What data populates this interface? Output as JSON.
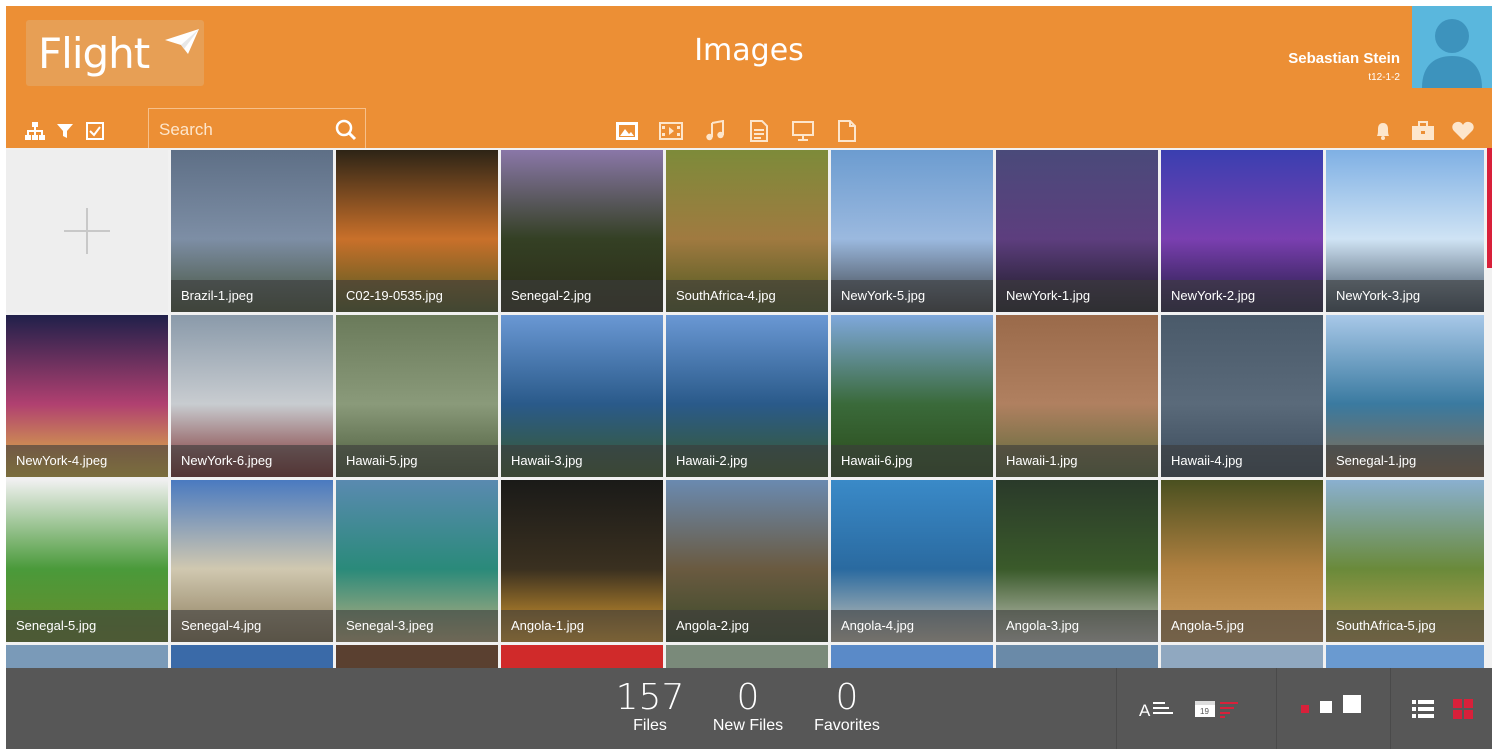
{
  "app": {
    "name": "Flight",
    "page_title": "Images"
  },
  "user": {
    "name": "Sebastian Stein",
    "id": "t12-1-2"
  },
  "search": {
    "placeholder": "Search"
  },
  "toolbar": {
    "left_icons": [
      "hierarchy-icon",
      "filter-icon",
      "checkbox-icon"
    ],
    "type_icons": [
      "image-icon",
      "video-icon",
      "music-icon",
      "document-icon",
      "presentation-icon",
      "file-icon"
    ],
    "right_icons": [
      "bell-icon",
      "briefcase-icon",
      "heart-icon"
    ]
  },
  "grid": {
    "add_tile": "plus-icon",
    "items": [
      {
        "name": "Brazil-1.jpeg"
      },
      {
        "name": "C02-19-0535.jpg"
      },
      {
        "name": "Senegal-2.jpg"
      },
      {
        "name": "SouthAfrica-4.jpg"
      },
      {
        "name": "NewYork-5.jpg"
      },
      {
        "name": "NewYork-1.jpg"
      },
      {
        "name": "NewYork-2.jpg"
      },
      {
        "name": "NewYork-3.jpg"
      },
      {
        "name": "NewYork-4.jpeg"
      },
      {
        "name": "NewYork-6.jpeg"
      },
      {
        "name": "Hawaii-5.jpg"
      },
      {
        "name": "Hawaii-3.jpg"
      },
      {
        "name": "Hawaii-2.jpg"
      },
      {
        "name": "Hawaii-6.jpg"
      },
      {
        "name": "Hawaii-1.jpg"
      },
      {
        "name": "Hawaii-4.jpg"
      },
      {
        "name": "Senegal-1.jpg"
      },
      {
        "name": "Senegal-5.jpg"
      },
      {
        "name": "Senegal-4.jpg"
      },
      {
        "name": "Senegal-3.jpeg"
      },
      {
        "name": "Angola-1.jpg"
      },
      {
        "name": "Angola-2.jpg"
      },
      {
        "name": "Angola-4.jpg"
      },
      {
        "name": "Angola-3.jpg"
      },
      {
        "name": "Angola-5.jpg"
      },
      {
        "name": "SouthAfrica-5.jpg"
      }
    ]
  },
  "stats": {
    "files": {
      "value": "157",
      "label": "Files"
    },
    "new_files": {
      "value": "0",
      "label": "New Files"
    },
    "favorites": {
      "value": "0",
      "label": "Favorites"
    }
  },
  "footer_icons": {
    "sort": [
      "sort-alpha-icon",
      "sort-date-icon"
    ],
    "sizes": [
      "size-small-icon",
      "size-medium-icon",
      "size-large-icon"
    ],
    "views": [
      "list-view-icon",
      "grid-view-icon"
    ]
  },
  "colors": {
    "header": "#ec8f35",
    "footer": "#575757",
    "accent": "#d8203a",
    "avatar": "#5ab7dd"
  }
}
